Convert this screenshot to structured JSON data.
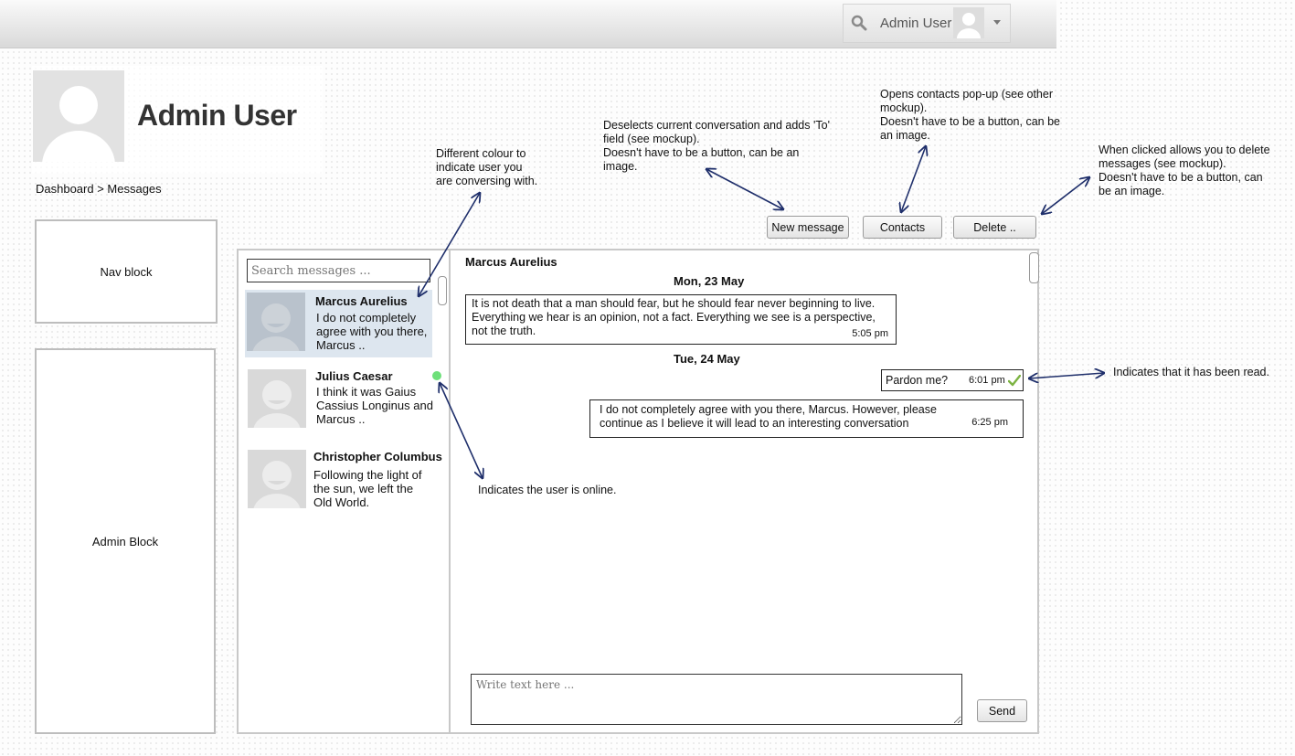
{
  "topbar": {
    "user_name": "Admin User"
  },
  "profile": {
    "name": "Admin User"
  },
  "breadcrumb": "Dashboard > Messages",
  "blocks": {
    "nav": "Nav block",
    "admin": "Admin Block"
  },
  "toolbar": {
    "new_message": "New message",
    "contacts": "Contacts",
    "delete": "Delete .."
  },
  "search": {
    "placeholder": "Search messages ..."
  },
  "conversations": [
    {
      "name": "Marcus Aurelius",
      "preview": "I do not completely agree with you there, Marcus ..",
      "selected": true,
      "online": false
    },
    {
      "name": "Julius Caesar",
      "preview": "I think it was Gaius Cassius Longinus and Marcus ..",
      "selected": false,
      "online": true
    },
    {
      "name": "Christopher Columbus",
      "preview": "Following the light of the sun, we left the Old World.",
      "selected": false,
      "online": false
    }
  ],
  "chat": {
    "title": "Marcus Aurelius",
    "days": [
      {
        "date": "Mon, 23 May",
        "messages": [
          {
            "text": "It is not death that a man should fear, but he should fear never beginning to live. Everything we hear is an opinion, not a fact. Everything we see is a perspective, not the truth.",
            "time": "5:05 pm"
          }
        ]
      },
      {
        "date": "Tue, 24 May",
        "messages": [
          {
            "text": "Pardon me?",
            "time": "6:01 pm",
            "read": true
          },
          {
            "text": "I do not completely agree with you there, Marcus. However, please continue as I believe it will lead to an interesting conversation",
            "time": "6:25 pm"
          }
        ]
      }
    ],
    "compose_placeholder": "Write text here ...",
    "send": "Send"
  },
  "annotations": {
    "selected_colour": "Different colour to\nindicate user you\nare conversing with.",
    "new_message": "Deselects current conversation and adds 'To'\nfield (see mockup).\nDoesn't have to be a button, can be an\nimage.",
    "contacts": "Opens contacts pop-up (see other\nmockup).\nDoesn't have to be a button, can be\nan image.",
    "delete": "When clicked allows you to delete\nmessages (see mockup).\nDoesn't have to be a button, can\nbe an image.",
    "read": "Indicates that it has been read.",
    "online": "Indicates the user is online."
  },
  "colors": {
    "selected_bg": "#dde6ef",
    "online": "#6ee07a",
    "read_check": "#7cb342",
    "arrow": "#1f2f6b"
  }
}
